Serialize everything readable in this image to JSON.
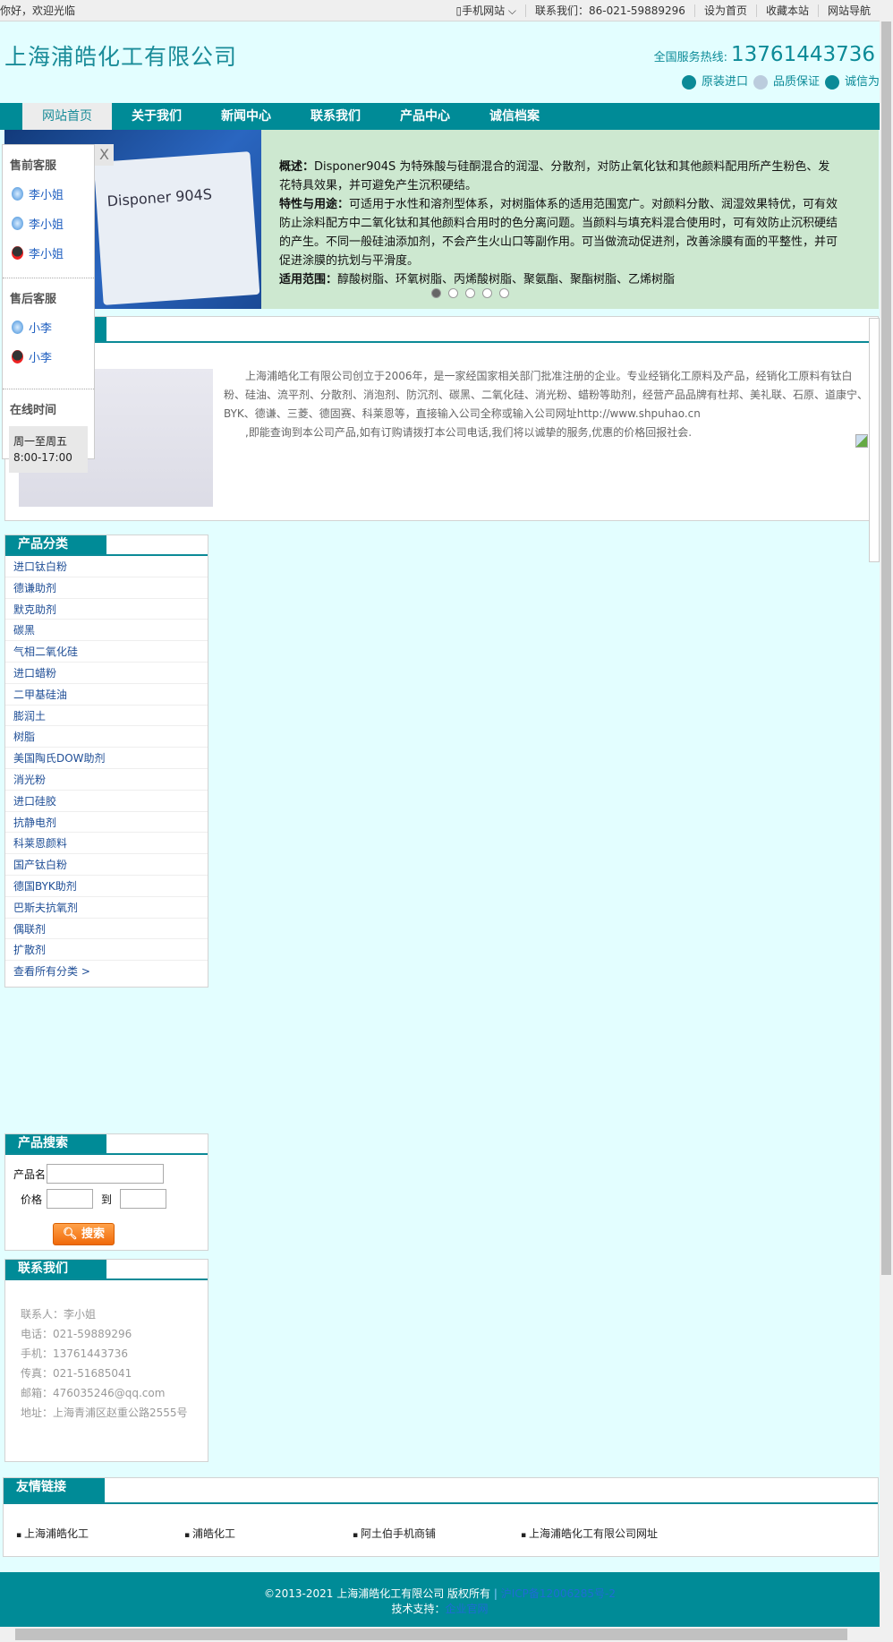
{
  "topbar": {
    "welcome": "你好，欢迎光临",
    "mobile": "手机网站",
    "contact": "联系我们：86-021-59889296",
    "set_home": "设为首页",
    "bookmark": "收藏本站",
    "sitemap": "网站导航"
  },
  "header": {
    "company": "上海浦皓化工有限公司",
    "hotline_label": "全国服务热线:",
    "hotline": "13761443736",
    "badges": [
      "原装进口",
      "品质保证",
      "诚信为本"
    ]
  },
  "nav": [
    "网站首页",
    "关于我们",
    "新闻中心",
    "联系我们",
    "产品中心",
    "诚信档案"
  ],
  "banner": {
    "image_text": "Disponer 904S",
    "lines": [
      {
        "k": "概述：",
        "v": "Disponer904S 为特殊酸与硅酮混合的润湿、分散剂，对防止氧化钛和其他颜料配用所产生粉色、发花特具效果，并可避免产生沉积硬结。"
      },
      {
        "k": "特性与用途：",
        "v": "可适用于水性和溶剂型体系，对树脂体系的适用范围宽广。对颜料分散、润湿效果特优，可有效防止涂料配方中二氧化钛和其他颜料合用时的色分离问题。当颜料与填充料混合使用时，可有效防止沉积硬结的产生。不同一般硅油添加剂，不会产生火山口等副作用。可当做流动促进剂，改善涂膜有面的平整性，并可促进涂膜的抗划与平滑度。"
      },
      {
        "k": "适用范围：",
        "v": "醇酸树脂、环氧树脂、丙烯酸树脂、聚氨酯、聚酯树脂、乙烯树脂"
      }
    ],
    "slides": 5,
    "active_slide": 1
  },
  "service": {
    "pre_title": "售前客服",
    "pre": [
      "李小姐",
      "李小姐",
      "李小姐"
    ],
    "after_title": "售后客服",
    "after": [
      "小李",
      "小李"
    ],
    "time_title": "在线时间",
    "days": "周一至周五",
    "hours": "8:00-17:00",
    "close": "X"
  },
  "about": {
    "p1": "上海浦皓化工有限公司创立于2006年，是一家经国家相关部门批准注册的企业。专业经销化工原料及产品，经销化工原料有钛白粉、硅油、流平剂、分散剂、消泡剂、防沉剂、碳黑、二氧化硅、消光粉、蜡粉等助剂，经营产品品牌有杜邦、美礼联、石原、道康宁、BYK、德谦、三菱、德固赛、科莱恩等，直接输入公司全称或输入公司网址http://www.shpuhao.cn",
    "p2": ",即能查询到本公司产品,如有订购请拨打本公司电话,我们将以诚挚的服务,优惠的价格回报社会."
  },
  "categories": {
    "title": "产品分类",
    "items": [
      "进口钛白粉",
      "德谦助剂",
      "默克助剂",
      "碳黑",
      "气相二氧化硅",
      "进口蜡粉",
      "二甲基硅油",
      "膨润土",
      "树脂",
      "美国陶氏DOW助剂",
      "消光粉",
      "进口硅胶",
      "抗静电剂",
      "科莱恩颜料",
      "国产钛白粉",
      "德国BYK助剂",
      "巴斯夫抗氧剂",
      "偶联剂",
      "扩散剂"
    ],
    "all": "查看所有分类 >"
  },
  "search": {
    "title": "产品搜索",
    "name_label": "产品名",
    "price_label": "价格",
    "to_label": "到",
    "button": "搜索"
  },
  "contact": {
    "title": "联系我们",
    "lines": [
      "联系人：李小姐",
      "电话：021-59889296",
      "手机：13761443736",
      "传真：021-51685041",
      "邮箱：476035246@qq.com",
      "地址：上海青浦区赵重公路2555号"
    ]
  },
  "links": {
    "title": "友情链接",
    "items": [
      "上海浦皓化工",
      "浦皓化工",
      "阿土伯手机商铺",
      "上海浦皓化工有限公司网址"
    ]
  },
  "footer": {
    "copyright": "©2013-2021 上海浦皓化工有限公司 版权所有",
    "sep": "|",
    "icp": "沪ICP备12006285号-2",
    "support_label": "技术支持：",
    "support": "企业官网"
  },
  "colors": {
    "teal": "#008b97",
    "banner_bg": "#cde8d0",
    "page_bg": "#e3feff",
    "button": "#f07a1a"
  }
}
